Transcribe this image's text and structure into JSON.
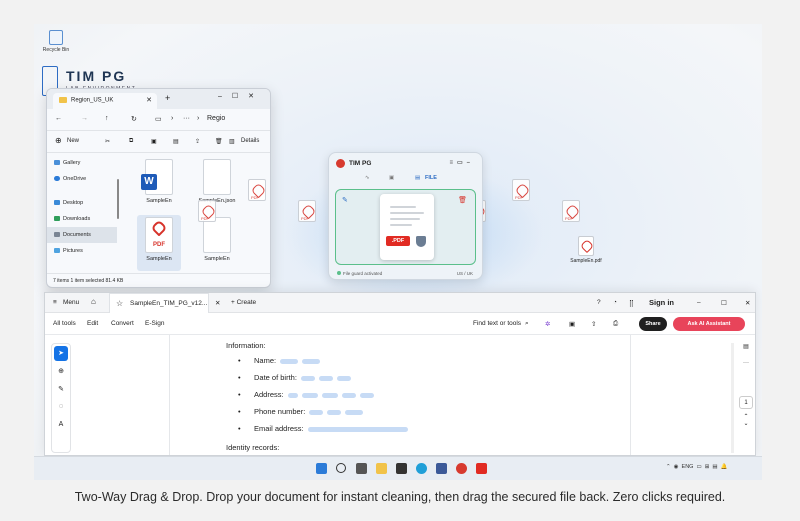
{
  "caption": "Two-Way Drag & Drop. Drop your document for instant cleaning, then drag the secured file back. Zero clicks required.",
  "desktop": {
    "recycle_bin": "Recycle Bin",
    "brand_name": "TIM PG",
    "brand_sub": "LAB ENVIRONMENT"
  },
  "explorer": {
    "tab_title": "Region_US_UK",
    "address": "Regio",
    "new_label": "New",
    "details_label": "Details",
    "sidebar": [
      "Gallery",
      "OneDrive",
      "Desktop",
      "Downloads",
      "Documents",
      "Pictures"
    ],
    "files": [
      {
        "name": "SampleEn",
        "type": "word"
      },
      {
        "name": "SampleEn.json",
        "type": "generic"
      },
      {
        "name": "SampleEn",
        "type": "pdf"
      },
      {
        "name": "SampleEn",
        "type": "generic"
      }
    ],
    "status": "7 items    1 item selected  81.4 KB"
  },
  "cleaner": {
    "title": "TIM PG",
    "nav_file": "FILE",
    "badge": ".PDF",
    "footer_left": "File guard activated",
    "footer_right": "US / UK"
  },
  "floating": {
    "pdf_label": "PDF"
  },
  "downloaded_file": "SampleEn.pdf",
  "acrobat": {
    "menu": "Menu",
    "tab_title": "SampleEn_TIM_PG_v12...",
    "create": "+ Create",
    "sign_in": "Sign in",
    "menus": [
      "All tools",
      "Edit",
      "Convert",
      "E-Sign"
    ],
    "find": "Find text or tools",
    "share": "Share",
    "ai": "Ask AI Assistant",
    "section": "Information:",
    "fields": [
      "Name:",
      "Date of birth:",
      "Address:",
      "Phone number:",
      "Email address:"
    ],
    "identity": "Identity records:",
    "page_num": "1"
  },
  "taskbar": {
    "lang": "ENG"
  }
}
